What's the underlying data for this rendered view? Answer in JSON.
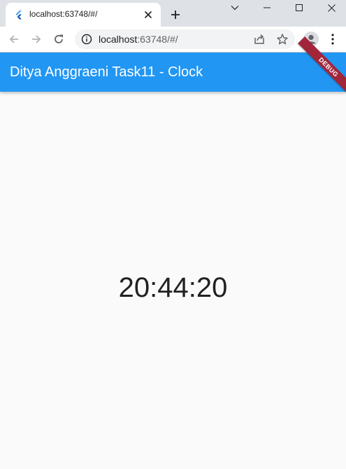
{
  "browser": {
    "tab": {
      "title": "localhost:63748/#/",
      "favicon": "flutter-icon"
    },
    "new_tab_icon": "plus-icon",
    "window_controls": [
      "chevron-down-icon",
      "minimize-icon",
      "maximize-icon",
      "close-icon"
    ],
    "address_bar": {
      "host": "localhost",
      "rest": ":63748/#/"
    }
  },
  "app": {
    "title": "Ditya Anggraeni Task11 - Clock",
    "debug_banner": "DEBUG",
    "clock": "20:44:20"
  },
  "colors": {
    "appbar": "#2196f3",
    "debug_banner": "#a1263a",
    "background": "#fafafa"
  }
}
